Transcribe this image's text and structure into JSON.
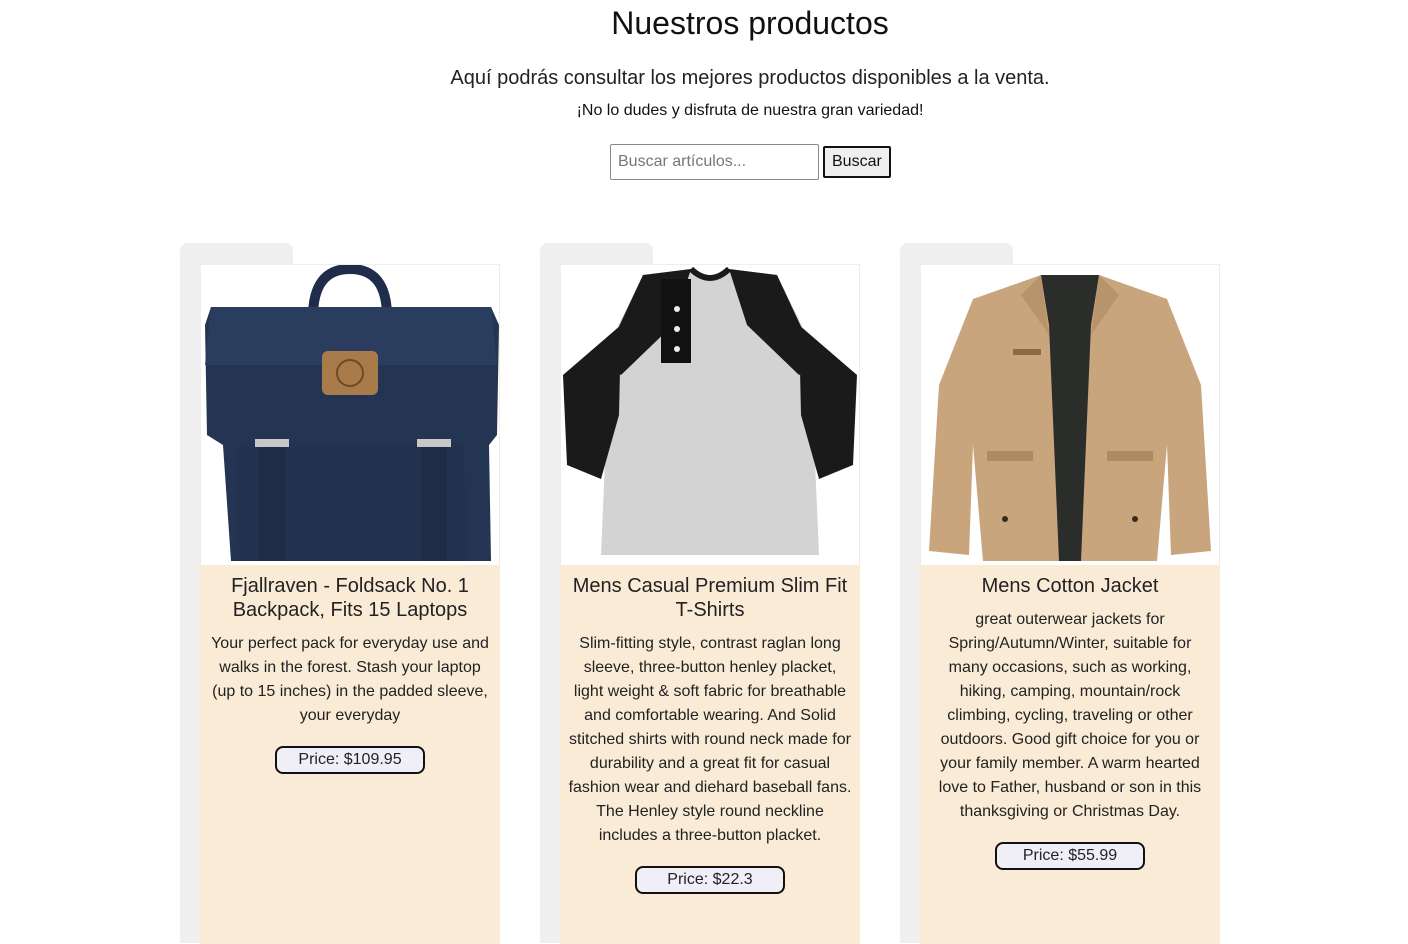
{
  "header": {
    "title": "Nuestros productos",
    "subtitle": "Aquí podrás consultar los mejores productos disponibles a la venta.",
    "tagline": "¡No lo dudes y disfruta de nuestra gran variedad!"
  },
  "search": {
    "placeholder": "Buscar artículos...",
    "value": "",
    "button_label": "Buscar"
  },
  "products": [
    {
      "title": "Fjallraven - Foldsack No. 1 Backpack, Fits 15 Laptops",
      "description": "Your perfect pack for everyday use and walks in the forest. Stash your laptop (up to 15 inches) in the padded sleeve, your everyday",
      "price": "Price: $109.95",
      "image": "backpack-image"
    },
    {
      "title": "Mens Casual Premium Slim Fit T-Shirts",
      "description": "Slim-fitting style, contrast raglan long sleeve, three-button henley placket, light weight & soft fabric for breathable and comfortable wearing. And Solid stitched shirts with round neck made for durability and a great fit for casual fashion wear and diehard baseball fans. The Henley style round neckline includes a three-button placket.",
      "price": "Price: $22.3",
      "image": "tshirt-image"
    },
    {
      "title": "Mens Cotton Jacket",
      "description": "great outerwear jackets for Spring/Autumn/Winter, suitable for many occasions, such as working, hiking, camping, mountain/rock climbing, cycling, traveling or other outdoors. Good gift choice for you or your family member. A warm hearted love to Father, husband or son in this thanksgiving or Christmas Day.",
      "price": "Price: $55.99",
      "image": "jacket-image"
    }
  ],
  "colors": {
    "card_background": "#faebd7",
    "card_tab": "#efefef",
    "price_badge": "#f0eef6"
  }
}
